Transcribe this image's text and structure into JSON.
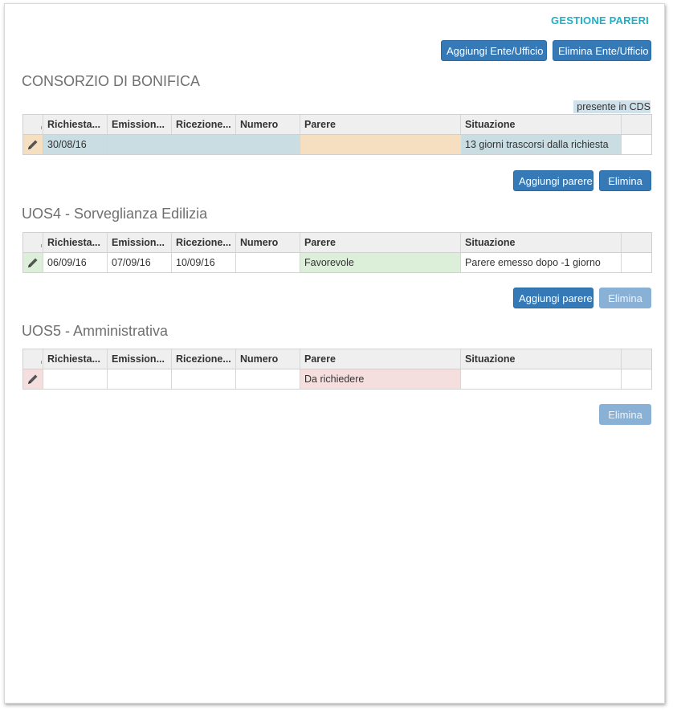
{
  "panel": {
    "title": "GESTIONE PARERI",
    "add_ente_label": "Aggiungi Ente/Ufficio",
    "delete_ente_label": "Elimina Ente/Ufficio"
  },
  "columns": [
    "Richiesta...",
    "Emission...",
    "Ricezione...",
    "Numero",
    "Parere",
    "Situazione"
  ],
  "sections": [
    {
      "title": "CONSORZIO DI BONIFICA",
      "note": "presente in CDS",
      "row": {
        "richiesta": "30/08/16",
        "emissione": "",
        "ricezione": "",
        "numero": "",
        "parere": "",
        "situazione": "13 giorni trascorsi dalla richiesta"
      },
      "add_label": "Aggiungi parere",
      "delete_label": "Elimina"
    },
    {
      "title": "UOS4 - Sorveglianza Edilizia",
      "row": {
        "richiesta": "06/09/16",
        "emissione": "07/09/16",
        "ricezione": "10/09/16",
        "numero": "",
        "parere": "Favorevole",
        "situazione": "Parere emesso dopo -1 giorno"
      },
      "add_label": "Aggiungi parere",
      "delete_label": "Elimina"
    },
    {
      "title": "UOS5 - Amministrativa",
      "row": {
        "richiesta": "",
        "emissione": "",
        "ricezione": "",
        "numero": "",
        "parere": "Da richiedere",
        "situazione": ""
      },
      "delete_label": "Elimina"
    }
  ],
  "colors": {
    "accent": "#1fb0c9",
    "button": "#3579b7",
    "button_disabled": "#89b1d6",
    "row_info": "#c9dde3",
    "parere_pending": "#f6dfc0",
    "parere_ok": "#dcefd8",
    "parere_missing": "#f4dede",
    "pencil_orange": "#f6dfc0",
    "pencil_green": "#dcefd8",
    "pencil_red": "#f4dede"
  },
  "icons": {
    "edit": "pencil-icon"
  }
}
